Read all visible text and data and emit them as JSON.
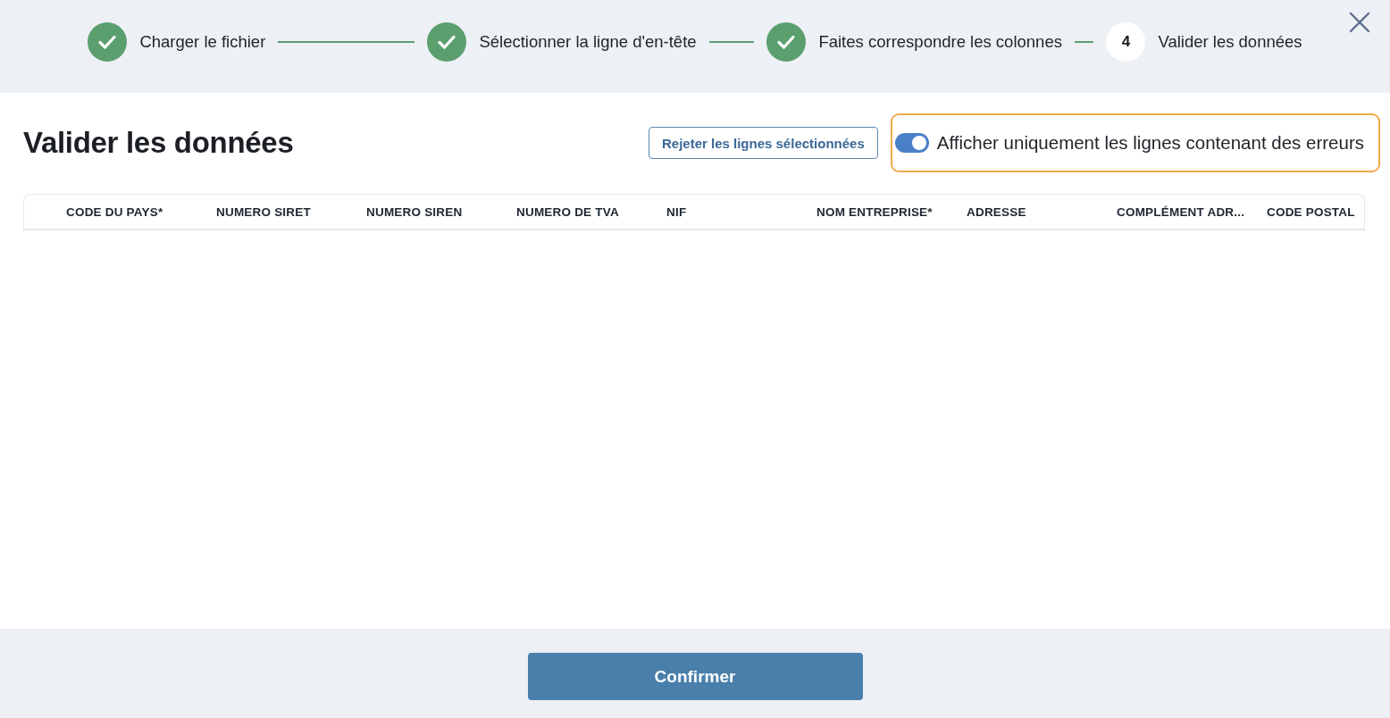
{
  "stepper": {
    "steps": [
      {
        "label": "Charger le fichier",
        "completed": true
      },
      {
        "label": "Sélectionner la ligne d'en-tête",
        "completed": true
      },
      {
        "label": "Faites correspondre les colonnes",
        "completed": true
      },
      {
        "label": "Valider les données",
        "completed": false,
        "number": "4"
      }
    ]
  },
  "page": {
    "title": "Valider les données"
  },
  "reject_button": {
    "label": "Rejeter les lignes sélectionnées"
  },
  "error_filter": {
    "label": "Afficher uniquement les lignes contenant des erreurs",
    "on": true,
    "focused": true
  },
  "table": {
    "columns": [
      "CODE DU PAYS*",
      "NUMERO SIRET",
      "NUMERO SIREN",
      "NUMERO DE TVA",
      "NIF",
      "NOM ENTREPRISE*",
      "ADRESSE",
      "COMPLÉMENT ADR...",
      "CODE POSTAL"
    ]
  },
  "footer": {
    "confirm_button": {
      "label": "Confirmer"
    }
  }
}
